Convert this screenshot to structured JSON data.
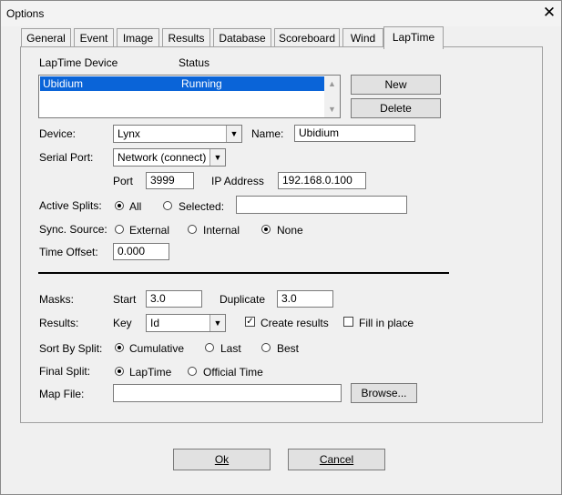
{
  "window": {
    "title": "Options",
    "close_glyph": "✕"
  },
  "tabs": [
    "General",
    "Event",
    "Image",
    "Results",
    "Database",
    "Scoreboard",
    "Wind",
    "LapTime"
  ],
  "active_tab": "LapTime",
  "device_list": {
    "col_device": "LapTime Device",
    "col_status": "Status",
    "rows": [
      {
        "device": "Ubidium",
        "status": "Running"
      }
    ],
    "scroll_up": "▲",
    "scroll_down": "▼"
  },
  "buttons": {
    "new": "New",
    "delete": "Delete",
    "browse": "Browse...",
    "ok": "Ok",
    "cancel": "Cancel"
  },
  "device": {
    "label": "Device:",
    "value": "Lynx",
    "name_label": "Name:",
    "name_value": "Ubidium"
  },
  "serial": {
    "label": "Serial Port:",
    "value": "Network (connect)",
    "port_label": "Port",
    "port_value": "3999",
    "ip_label": "IP Address",
    "ip_value": "192.168.0.100"
  },
  "splits": {
    "label": "Active Splits:",
    "all": "All",
    "selected": "Selected:",
    "selected_value": "",
    "choice": "All"
  },
  "sync": {
    "label": "Sync. Source:",
    "external": "External",
    "internal": "Internal",
    "none": "None",
    "choice": "None"
  },
  "offset": {
    "label": "Time Offset:",
    "value": "0.000"
  },
  "masks": {
    "label": "Masks:",
    "start_label": "Start",
    "start_value": "3.0",
    "dup_label": "Duplicate",
    "dup_value": "3.0"
  },
  "results": {
    "label": "Results:",
    "key_label": "Key",
    "key_value": "Id",
    "create_label": "Create results",
    "create_checked": true,
    "fill_label": "Fill in place",
    "fill_checked": false
  },
  "sort": {
    "label": "Sort By Split:",
    "cumulative": "Cumulative",
    "last": "Last",
    "best": "Best",
    "choice": "Cumulative"
  },
  "final": {
    "label": "Final Split:",
    "laptime": "LapTime",
    "official": "Official Time",
    "choice": "LapTime"
  },
  "mapfile": {
    "label": "Map File:",
    "value": ""
  },
  "combo_arrow": "▼",
  "check_glyph": "✓"
}
